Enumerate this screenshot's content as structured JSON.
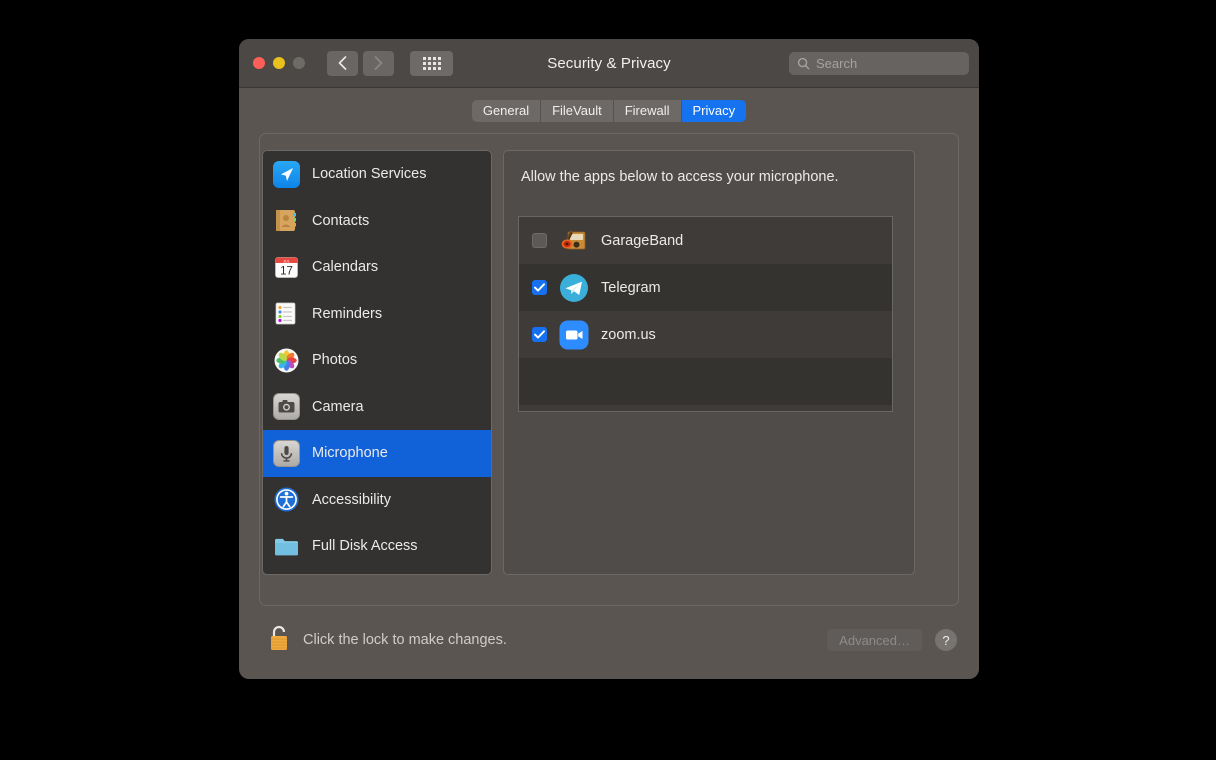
{
  "window": {
    "title": "Security & Privacy",
    "traffic_lights": [
      "close",
      "minimize",
      "zoom"
    ],
    "nav": {
      "back": "back-arrow",
      "forward": "forward-arrow",
      "grid": "show-all-grid"
    },
    "search": {
      "placeholder": "Search",
      "value": "",
      "icon": "search-icon"
    }
  },
  "tabs": [
    {
      "label": "General",
      "active": false
    },
    {
      "label": "FileVault",
      "active": false
    },
    {
      "label": "Firewall",
      "active": false
    },
    {
      "label": "Privacy",
      "active": true
    }
  ],
  "sidebar": {
    "items": [
      {
        "label": "Location Services",
        "icon": "location-arrow-icon",
        "selected": false
      },
      {
        "label": "Contacts",
        "icon": "contacts-book-icon",
        "selected": false
      },
      {
        "label": "Calendars",
        "icon": "calendar-icon",
        "selected": false
      },
      {
        "label": "Reminders",
        "icon": "reminders-list-icon",
        "selected": false
      },
      {
        "label": "Photos",
        "icon": "photos-pinwheel-icon",
        "selected": false
      },
      {
        "label": "Camera",
        "icon": "camera-icon",
        "selected": false
      },
      {
        "label": "Microphone",
        "icon": "microphone-icon",
        "selected": true
      },
      {
        "label": "Accessibility",
        "icon": "accessibility-icon",
        "selected": false
      },
      {
        "label": "Full Disk Access",
        "icon": "folder-icon",
        "selected": false
      }
    ]
  },
  "detail": {
    "description": "Allow the apps below to access your microphone.",
    "apps": [
      {
        "name": "GarageBand",
        "checked": false,
        "icon": "garageband-icon"
      },
      {
        "name": "Telegram",
        "checked": true,
        "icon": "telegram-icon"
      },
      {
        "name": "zoom.us",
        "checked": true,
        "icon": "zoom-icon"
      }
    ]
  },
  "footer": {
    "lock_icon": "unlocked-padlock-icon",
    "lock_message": "Click the lock to make changes.",
    "advanced_label": "Advanced…",
    "help_label": "?"
  },
  "colors": {
    "accent_blue": "#1573f0",
    "selection_blue": "#1161d8",
    "window_bg": "#5a5551",
    "titlebar_bg": "#4b4845",
    "list_bg": "#343230"
  }
}
